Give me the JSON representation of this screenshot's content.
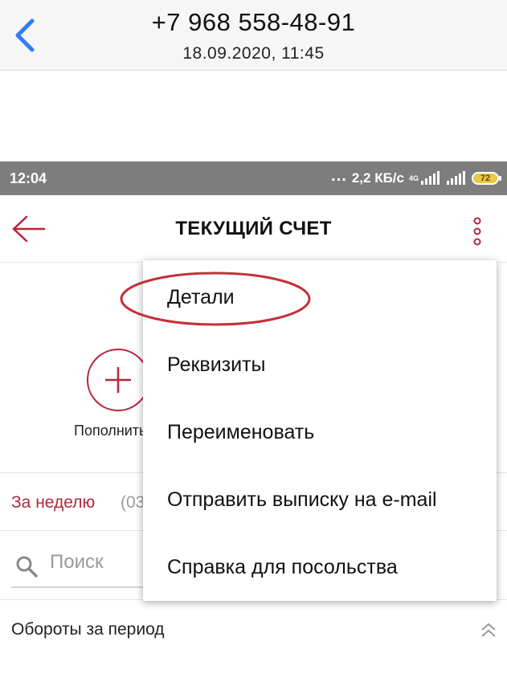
{
  "messenger": {
    "phone": "+7 968 558-48-91",
    "date": "18.09.2020, 11:45",
    "back_icon": "chevron-left-icon",
    "accent": "#2f7df6"
  },
  "status_bar": {
    "time": "12:04",
    "dots": "...",
    "speed": "2,2 КБ/с",
    "network": "4G",
    "battery": "72"
  },
  "app_bar": {
    "title": "ТЕКУЩИЙ СЧЕТ",
    "back_icon": "arrow-left-icon",
    "more_icon": "more-vertical-icon",
    "accent": "#b8243a"
  },
  "actions": {
    "topup_label": "Пополнить",
    "topup_icon": "plus-circle-icon"
  },
  "filter": {
    "period": "За неделю",
    "range": "(03"
  },
  "search": {
    "placeholder": "Поиск",
    "icon": "search-icon"
  },
  "turnover": {
    "label": "Обороты за период",
    "icon": "chevrons-up-icon"
  },
  "menu": {
    "items": [
      {
        "label": "Детали"
      },
      {
        "label": "Реквизиты"
      },
      {
        "label": "Переименовать"
      },
      {
        "label": "Отправить выписку на e-mail"
      },
      {
        "label": "Справка для посольства"
      }
    ],
    "highlight_color": "#c4303a"
  }
}
